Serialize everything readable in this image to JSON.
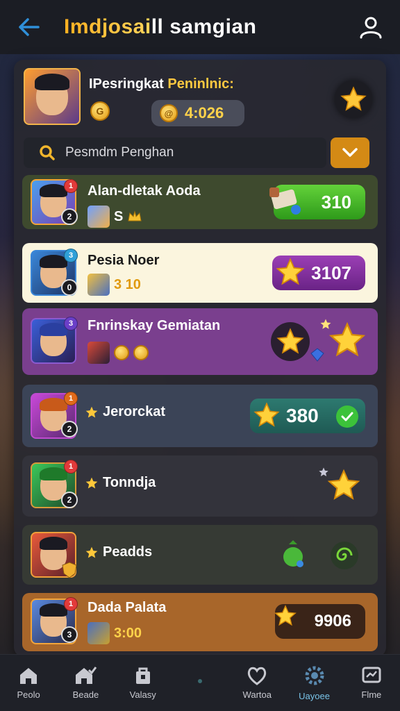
{
  "topbar": {
    "title": "Imdjosaill samgian",
    "back_icon": "arrow-left-icon",
    "profile_icon": "user-icon",
    "accent": "#2f8fd8"
  },
  "header": {
    "title_part1": "IPesringkat ",
    "title_part2": "Peninlnic:",
    "score": "4:026",
    "coin_symbol": "@",
    "coin_small_symbol": "G"
  },
  "search": {
    "label": "Pesmdm Penghan"
  },
  "rows": [
    {
      "name": "Alan-dletak Aoda",
      "value": "310",
      "sub_text": "S",
      "rank": "1",
      "level": "2"
    },
    {
      "name": "Pesia Noer",
      "value": "3107",
      "sub_text": "3 10",
      "rank": "3",
      "level": "0"
    },
    {
      "name": "Fnrinskay Gemiatan",
      "value": "",
      "sub_text": "",
      "rank": "3",
      "level": ""
    },
    {
      "name": "Jerorckat",
      "value": "380",
      "sub_text": "",
      "rank": "1",
      "level": "2"
    },
    {
      "name": "Tonndja",
      "value": "",
      "sub_text": "",
      "rank": "1",
      "level": "2"
    },
    {
      "name": "Peadds",
      "value": "",
      "sub_text": "",
      "rank": "",
      "level": ""
    },
    {
      "name": "Dada Palata",
      "value": "9906",
      "sub_text": "3:00",
      "rank": "1",
      "level": "3"
    }
  ],
  "nav": [
    {
      "label": "Peolo",
      "icon": "home-icon"
    },
    {
      "label": "Beade",
      "icon": "home-check-icon"
    },
    {
      "label": "Valasy",
      "icon": "bag-icon"
    },
    {
      "label": "",
      "icon": "dot-icon"
    },
    {
      "label": "Wartoa",
      "icon": "heart-icon"
    },
    {
      "label": "Uayoee",
      "icon": "gear-icon"
    },
    {
      "label": "Flme",
      "icon": "chart-icon"
    }
  ],
  "colors": {
    "row_green": "#3e4a2e",
    "row_cream": "#fbf5de",
    "row_purple": "#7a3f8e",
    "row_slate": "#3b4457",
    "row_dark": "#33333b",
    "row_dark2": "#363a34",
    "row_orange": "#a8662a"
  }
}
